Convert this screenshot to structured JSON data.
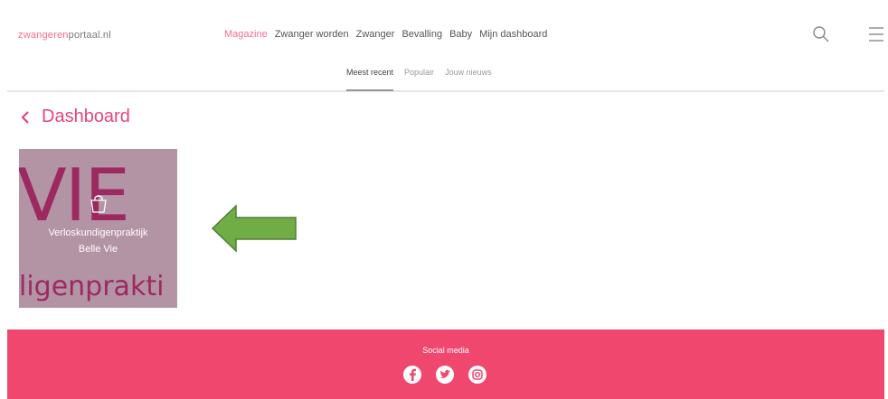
{
  "header": {
    "logo": {
      "part1": "zwangeren",
      "part2": "portaal.nl"
    },
    "nav": [
      {
        "label": "Magazine",
        "active": true
      },
      {
        "label": "Zwanger worden",
        "active": false
      },
      {
        "label": "Zwanger",
        "active": false
      },
      {
        "label": "Bevalling",
        "active": false
      },
      {
        "label": "Baby",
        "active": false
      },
      {
        "label": "Mijn dashboard",
        "active": false
      }
    ],
    "icons": {
      "search": "search-icon",
      "menu": "hamburger-menu-icon"
    }
  },
  "subnav": {
    "tabs": [
      {
        "label": "Meest recent",
        "active": true
      },
      {
        "label": "Populair",
        "active": false
      },
      {
        "label": "Jouw nieuws",
        "active": false
      }
    ]
  },
  "back": {
    "label": "Dashboard",
    "icon": "chevron-left-icon"
  },
  "card": {
    "image_text_top": "VIE",
    "image_text_bottom": "ligenprakti",
    "title_line1": "Verloskundigenpraktijk",
    "title_line2": "Belle Vie",
    "icon": "shopping-bag-icon"
  },
  "annotation": {
    "icon": "green-arrow-left-icon",
    "color": "#70ad47"
  },
  "footer": {
    "label": "Social media",
    "icons": [
      "facebook-icon",
      "twitter-icon",
      "instagram-icon"
    ]
  },
  "colors": {
    "accent": "#f0476f",
    "card_bg": "#b394a4",
    "card_text": "#9c2a60"
  }
}
